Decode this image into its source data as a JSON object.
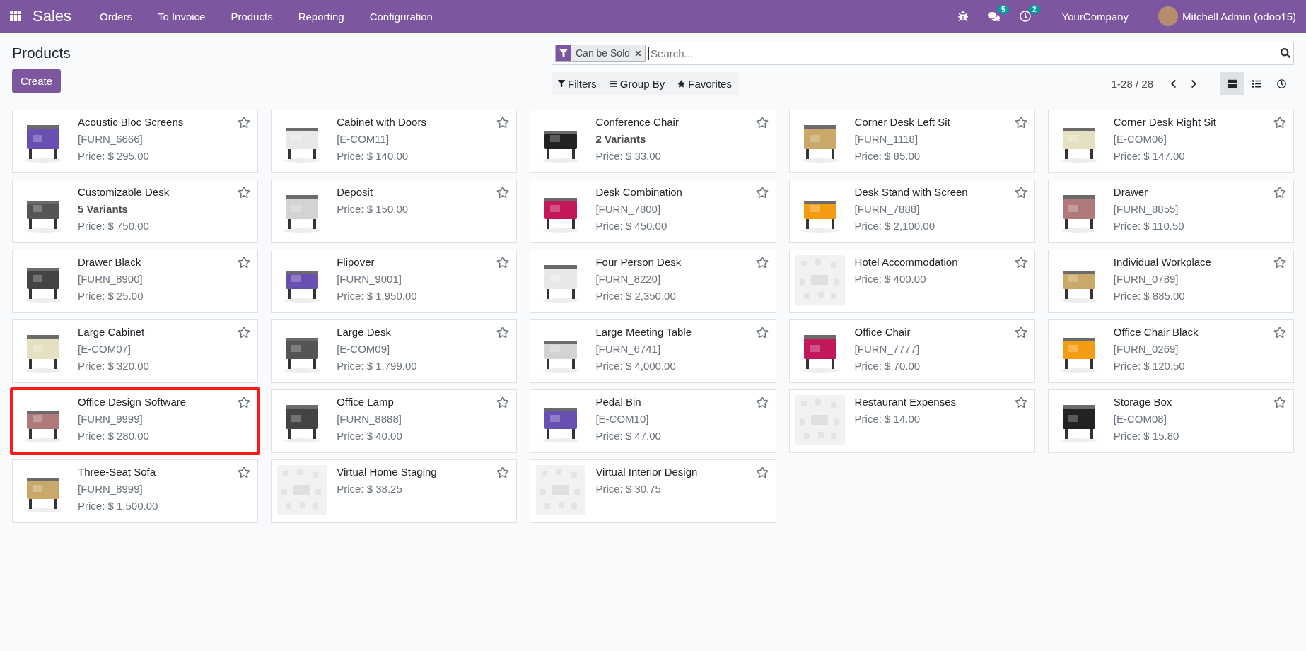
{
  "topbar": {
    "app": "Sales",
    "menu": [
      "Orders",
      "To Invoice",
      "Products",
      "Reporting",
      "Configuration"
    ],
    "messages_badge": "5",
    "activities_badge": "2",
    "company": "YourCompany",
    "user": "Mitchell Admin (odoo15)"
  },
  "control_panel": {
    "title": "Products",
    "create": "Create",
    "facet": "Can be Sold",
    "search_placeholder": "Search...",
    "filters": "Filters",
    "group_by": "Group By",
    "favorites": "Favorites",
    "pager": "1-28 / 28",
    "views": [
      {
        "kind": "kanban",
        "selected": true
      },
      {
        "kind": "list",
        "selected": false
      },
      {
        "kind": "activity",
        "selected": false
      }
    ]
  },
  "products": [
    {
      "name": "Acoustic Bloc Screens",
      "reference": "[FURN_6666]",
      "price": "Price: $ 295.00",
      "favorite": false,
      "highlighted": false
    },
    {
      "name": "Cabinet with Doors",
      "reference": "[E-COM11]",
      "price": "Price: $ 140.00",
      "favorite": false,
      "highlighted": false
    },
    {
      "name": "Conference Chair",
      "variants": "2 Variants",
      "price": "Price: $ 33.00",
      "favorite": false,
      "highlighted": false
    },
    {
      "name": "Corner Desk Left Sit",
      "reference": "[FURN_1118]",
      "price": "Price: $ 85.00",
      "favorite": false,
      "highlighted": false
    },
    {
      "name": "Corner Desk Right Sit",
      "reference": "[E-COM06]",
      "price": "Price: $ 147.00",
      "favorite": false,
      "highlighted": false
    },
    {
      "name": "Customizable Desk",
      "variants": "5 Variants",
      "price": "Price: $ 750.00",
      "favorite": false,
      "highlighted": false
    },
    {
      "name": "Deposit",
      "price": "Price: $ 150.00",
      "favorite": false,
      "highlighted": false
    },
    {
      "name": "Desk Combination",
      "reference": "[FURN_7800]",
      "price": "Price: $ 450.00",
      "favorite": false,
      "highlighted": false
    },
    {
      "name": "Desk Stand with Screen",
      "reference": "[FURN_7888]",
      "price": "Price: $ 2,100.00",
      "favorite": false,
      "highlighted": false
    },
    {
      "name": "Drawer",
      "reference": "[FURN_8855]",
      "price": "Price: $ 110.50",
      "favorite": false,
      "highlighted": false
    },
    {
      "name": "Drawer Black",
      "reference": "[FURN_8900]",
      "price": "Price: $ 25.00",
      "favorite": false,
      "highlighted": false
    },
    {
      "name": "Flipover",
      "reference": "[FURN_9001]",
      "price": "Price: $ 1,950.00",
      "favorite": false,
      "highlighted": false
    },
    {
      "name": "Four Person Desk",
      "reference": "[FURN_8220]",
      "price": "Price: $ 2,350.00",
      "favorite": false,
      "highlighted": false
    },
    {
      "name": "Hotel Accommodation",
      "price": "Price: $ 400.00",
      "kind": "placeholder",
      "favorite": false,
      "highlighted": false
    },
    {
      "name": "Individual Workplace",
      "reference": "[FURN_0789]",
      "price": "Price: $ 885.00",
      "favorite": false,
      "highlighted": false
    },
    {
      "name": "Large Cabinet",
      "reference": "[E-COM07]",
      "price": "Price: $ 320.00",
      "favorite": false,
      "highlighted": false
    },
    {
      "name": "Large Desk",
      "reference": "[E-COM09]",
      "price": "Price: $ 1,799.00",
      "favorite": false,
      "highlighted": false
    },
    {
      "name": "Large Meeting Table",
      "reference": "[FURN_6741]",
      "price": "Price: $ 4,000.00",
      "favorite": false,
      "highlighted": false
    },
    {
      "name": "Office Chair",
      "reference": "[FURN_7777]",
      "price": "Price: $ 70.00",
      "favorite": false,
      "highlighted": false
    },
    {
      "name": "Office Chair Black",
      "reference": "[FURN_0269]",
      "price": "Price: $ 120.50",
      "favorite": false,
      "highlighted": false
    },
    {
      "name": "Office Design Software",
      "reference": "[FURN_9999]",
      "price": "Price: $ 280.00",
      "favorite": false,
      "highlighted": true
    },
    {
      "name": "Office Lamp",
      "reference": "[FURN_8888]",
      "price": "Price: $ 40.00",
      "favorite": false,
      "highlighted": false
    },
    {
      "name": "Pedal Bin",
      "reference": "[E-COM10]",
      "price": "Price: $ 47.00",
      "favorite": false,
      "highlighted": false
    },
    {
      "name": "Restaurant Expenses",
      "price": "Price: $ 14.00",
      "kind": "placeholder",
      "favorite": false,
      "highlighted": false
    },
    {
      "name": "Storage Box",
      "reference": "[E-COM08]",
      "price": "Price: $ 15.80",
      "favorite": false,
      "highlighted": false
    },
    {
      "name": "Three-Seat Sofa",
      "reference": "[FURN_8999]",
      "price": "Price: $ 1,500.00",
      "favorite": false,
      "highlighted": false
    },
    {
      "name": "Virtual Home Staging",
      "price": "Price: $ 38.25",
      "kind": "placeholder",
      "favorite": false,
      "highlighted": false
    },
    {
      "name": "Virtual Interior Design",
      "price": "Price: $ 30.75",
      "kind": "placeholder",
      "favorite": false,
      "highlighted": false
    }
  ]
}
